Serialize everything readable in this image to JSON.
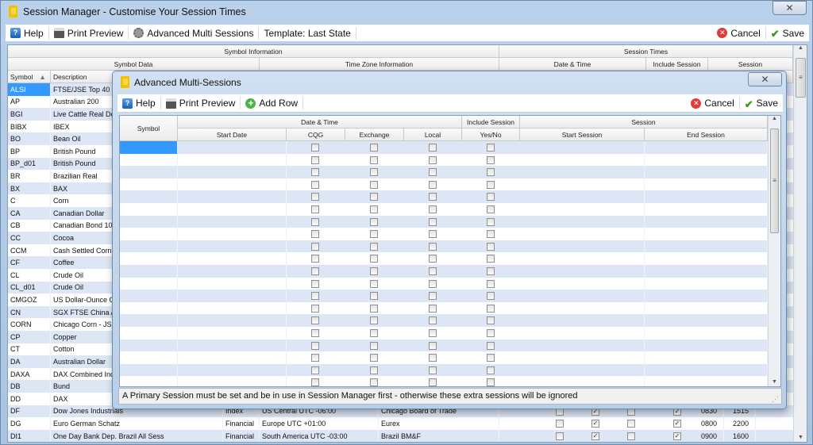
{
  "main": {
    "title": "Session Manager - Customise Your Session Times",
    "toolbar": {
      "help": "Help",
      "print_preview": "Print Preview",
      "advanced": "Advanced Multi Sessions",
      "template": "Template: Last State",
      "cancel": "Cancel",
      "save": "Save"
    },
    "headers": {
      "symbol_information": "Symbol Information",
      "session_times": "Session Times",
      "symbol_data": "Symbol Data",
      "time_zone_information": "Time Zone Information",
      "date_time": "Date & Time",
      "include_session": "Include Session",
      "session": "Session",
      "symbol": "Symbol",
      "description": "Description"
    },
    "rows": [
      {
        "symbol": "ALSI",
        "description": "FTSE/JSE Top 40",
        "selected": true
      },
      {
        "symbol": "AP",
        "description": "Australian 200"
      },
      {
        "symbol": "BGI",
        "description": "Live Cattle Real De"
      },
      {
        "symbol": "BIBX",
        "description": "IBEX"
      },
      {
        "symbol": "BO",
        "description": "Bean Oil"
      },
      {
        "symbol": "BP",
        "description": "British Pound"
      },
      {
        "symbol": "BP_d01",
        "description": "British Pound"
      },
      {
        "symbol": "BR",
        "description": "Brazilian Real"
      },
      {
        "symbol": "BX",
        "description": "BAX"
      },
      {
        "symbol": "C",
        "description": "Corn"
      },
      {
        "symbol": "CA",
        "description": "Canadian Dollar"
      },
      {
        "symbol": "CB",
        "description": "Canadian Bond 10y"
      },
      {
        "symbol": "CC",
        "description": "Cocoa"
      },
      {
        "symbol": "CCM",
        "description": "Cash Settled Corn"
      },
      {
        "symbol": "CF",
        "description": "Coffee"
      },
      {
        "symbol": "CL",
        "description": "Crude Oil"
      },
      {
        "symbol": "CL_d01",
        "description": "Crude Oil"
      },
      {
        "symbol": "CMGOZ",
        "description": "US Dollar-Ounce G"
      },
      {
        "symbol": "CN",
        "description": "SGX FTSE China A"
      },
      {
        "symbol": "CORN",
        "description": "Chicago Corn - JSE"
      },
      {
        "symbol": "CP",
        "description": "Copper"
      },
      {
        "symbol": "CT",
        "description": "Cotton"
      },
      {
        "symbol": "DA",
        "description": "Australian Dollar"
      },
      {
        "symbol": "DAXA",
        "description": "DAX Combined Ind"
      },
      {
        "symbol": "DB",
        "description": "Bund"
      },
      {
        "symbol": "DD",
        "description": "DAX"
      },
      {
        "symbol": "DF",
        "description": "Dow Jones Industrials",
        "type": "Index",
        "timezone": "US Central UTC -06:00",
        "exchange": "Chicago Board of Trade",
        "cqg": false,
        "exch": true,
        "local": false,
        "include": true,
        "start": "0830",
        "end": "1515"
      },
      {
        "symbol": "DG",
        "description": "Euro German Schatz",
        "type": "Financial",
        "timezone": "Europe UTC +01:00",
        "exchange": "Eurex",
        "cqg": false,
        "exch": true,
        "local": false,
        "include": true,
        "start": "0800",
        "end": "2200"
      },
      {
        "symbol": "DI1",
        "description": "One Day Bank Dep. Brazil All Sess",
        "type": "Financial",
        "timezone": "South America UTC -03:00",
        "exchange": "Brazil BM&F",
        "cqg": false,
        "exch": true,
        "local": false,
        "include": true,
        "start": "0900",
        "end": "1600"
      }
    ]
  },
  "dialog": {
    "title": "Advanced Multi-Sessions",
    "toolbar": {
      "help": "Help",
      "print_preview": "Print Preview",
      "add_row": "Add Row",
      "cancel": "Cancel",
      "save": "Save"
    },
    "headers": {
      "symbol": "Symbol",
      "date_time": "Date & Time",
      "include_session": "Include Session",
      "session": "Session",
      "start_date": "Start Date",
      "cqg": "CQG",
      "exchange": "Exchange",
      "local": "Local",
      "yes_no": "Yes/No",
      "start_session": "Start Session",
      "end_session": "End Session"
    },
    "row_count": 20,
    "status": "A Primary Session must be set and be in use in Session Manager first - otherwise these extra sessions will be ignored"
  },
  "colors": {
    "selection": "#3399ff",
    "alt_row": "#dce6f4"
  }
}
